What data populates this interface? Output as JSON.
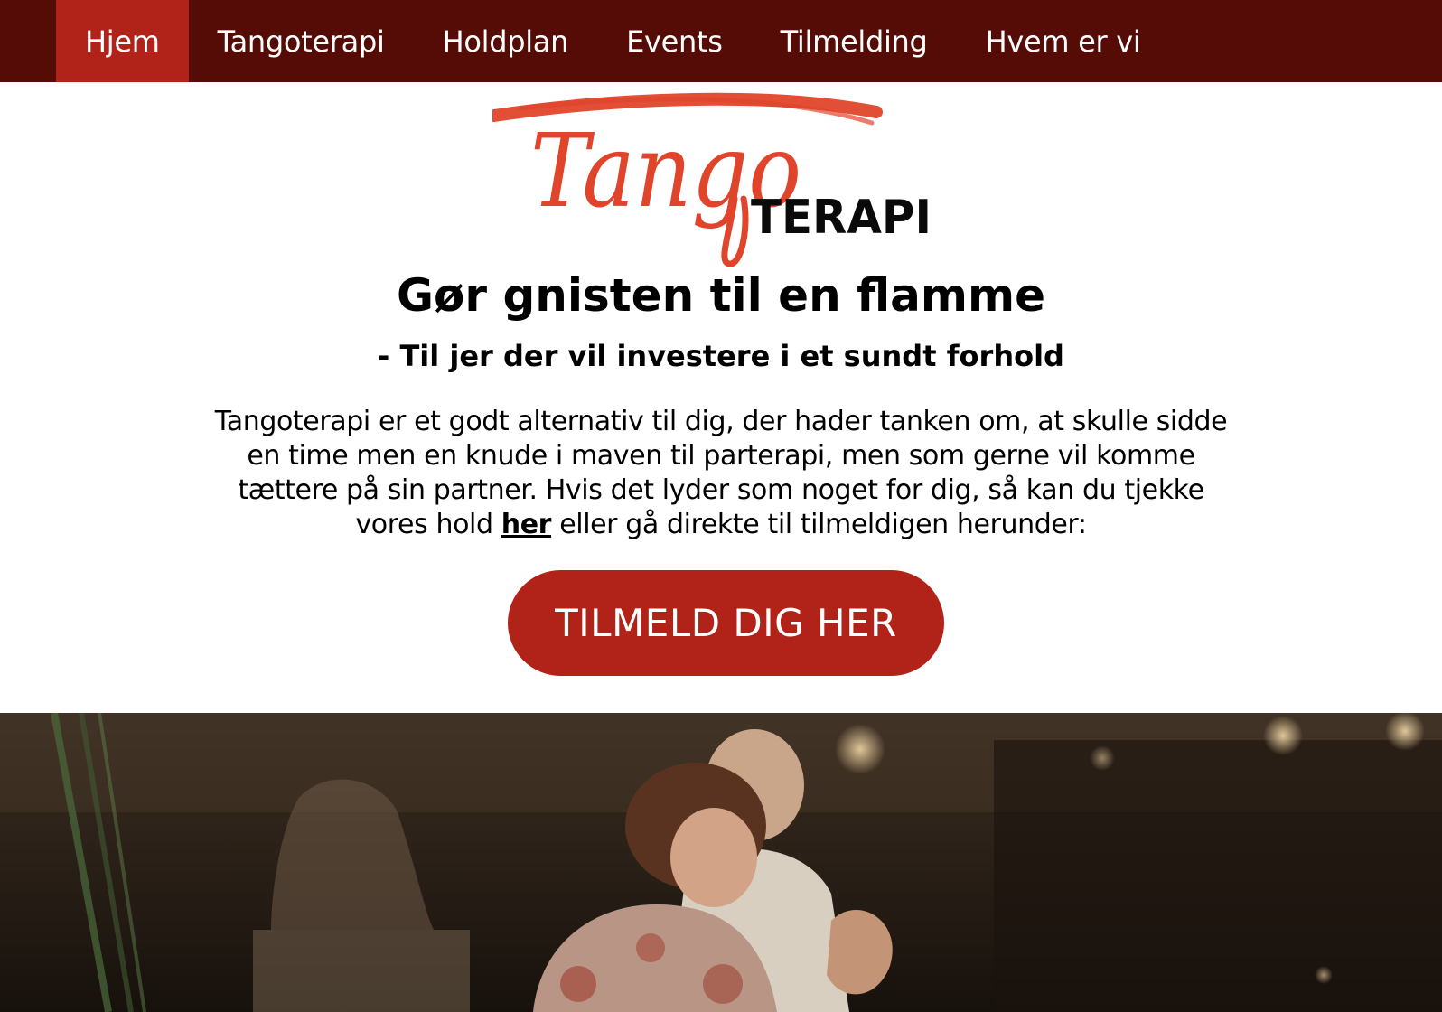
{
  "nav": {
    "items": [
      {
        "label": "Hjem",
        "active": true
      },
      {
        "label": "Tangoterapi",
        "active": false
      },
      {
        "label": "Holdplan",
        "active": false
      },
      {
        "label": "Events",
        "active": false
      },
      {
        "label": "Tilmelding",
        "active": false
      },
      {
        "label": "Hvem er vi",
        "active": false
      }
    ]
  },
  "logo": {
    "script_text": "Tango",
    "word_text": "TERAPI"
  },
  "hero_text": {
    "headline": "Gør gnisten til en flamme",
    "subheadline": "- Til jer der vil investere i et sundt forhold",
    "intro_before_link": "Tangoterapi er et godt alternativ til dig, der hader tanken om, at skulle sidde en time men en knude i maven til parterapi, men som gerne vil komme tættere på sin partner. Hvis det lyder som noget for dig, så kan du tjekke vores hold ",
    "intro_link": "her",
    "intro_after_link": " eller gå direkte til tilmeldigen herunder:"
  },
  "cta": {
    "label": "TILMELD DIG HER"
  },
  "colors": {
    "nav_background": "#560c06",
    "nav_active": "#b12318",
    "accent": "#b12318",
    "logo_red": "#e0442b"
  },
  "photo": {
    "subject": "couple-dancing-tango-photo"
  }
}
